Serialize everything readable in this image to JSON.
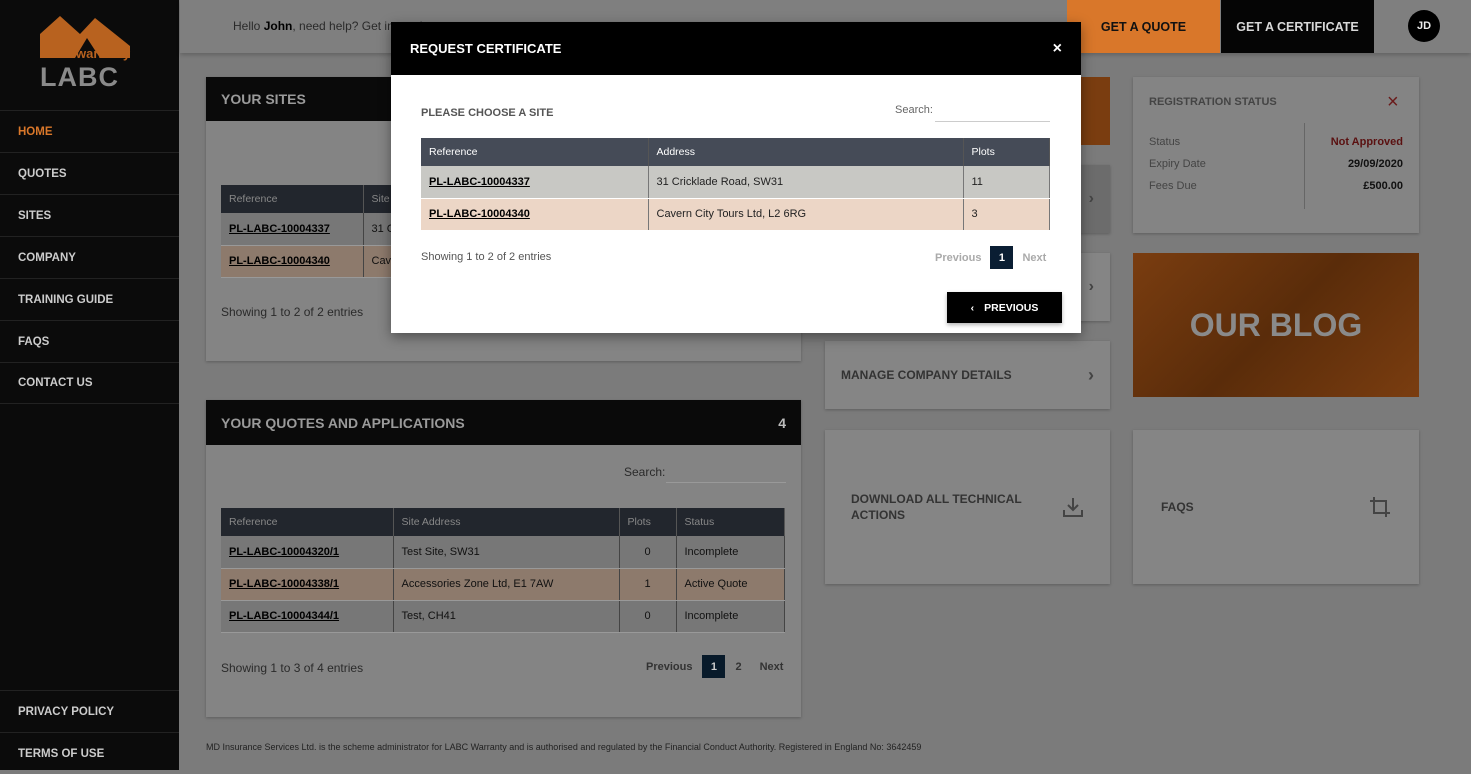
{
  "brand": {
    "logo_top": "warranty",
    "logo_bottom": "LABC",
    "accent": "#d9772a"
  },
  "sidebar": {
    "items": [
      {
        "label": "HOME",
        "active": true
      },
      {
        "label": "QUOTES"
      },
      {
        "label": "SITES"
      },
      {
        "label": "COMPANY"
      },
      {
        "label": "TRAINING GUIDE"
      },
      {
        "label": "FAQS"
      },
      {
        "label": "CONTACT US"
      }
    ],
    "bottom": [
      {
        "label": "PRIVACY POLICY"
      },
      {
        "label": "TERMS OF USE"
      }
    ]
  },
  "header": {
    "hello": "Hello ",
    "user": "John",
    "help": ", need help? Get in touch",
    "get_quote": "GET A QUOTE",
    "get_certificate": "GET A CERTIFICATE",
    "avatar": "JD"
  },
  "sites": {
    "title": "YOUR SITES",
    "columns": [
      "Reference",
      "Site"
    ],
    "rows": [
      {
        "ref": "PL-LABC-10004337",
        "site": "31 C"
      },
      {
        "ref": "PL-LABC-10004340",
        "site": "Cav"
      }
    ],
    "info": "Showing 1 to 2 of 2 entries"
  },
  "quotes": {
    "title": "YOUR QUOTES AND APPLICATIONS",
    "count": "4",
    "search_label": "Search:",
    "columns": [
      "Reference",
      "Site Address",
      "Plots",
      "Status"
    ],
    "rows": [
      {
        "ref": "PL-LABC-10004320/1",
        "address": "Test Site, SW31",
        "plots": "0",
        "status": "Incomplete"
      },
      {
        "ref": "PL-LABC-10004338/1",
        "address": "Accessories Zone Ltd, E1 7AW",
        "plots": "1",
        "status": "Active Quote"
      },
      {
        "ref": "PL-LABC-10004344/1",
        "address": "Test, CH41",
        "plots": "0",
        "status": "Incomplete"
      }
    ],
    "info": "Showing 1 to 3 of 4 entries",
    "prev": "Previous",
    "pages": [
      "1",
      "2"
    ],
    "next": "Next"
  },
  "registration": {
    "title": "REGISTRATION STATUS",
    "rows": [
      {
        "label": "Status",
        "value": "Not Approved"
      },
      {
        "label": "Expiry Date",
        "value": "29/09/2020"
      },
      {
        "label": "Fees Due",
        "value": "£500.00"
      }
    ]
  },
  "tiles": {
    "manage": "MANAGE COMPANY DETAILS",
    "download": "DOWNLOAD ALL TECHNICAL ACTIONS",
    "blog": "OUR BLOG",
    "faqs": "FAQS"
  },
  "footer": "MD Insurance Services Ltd. is the scheme administrator for LABC Warranty and is authorised and regulated by the Financial Conduct Authority. Registered in England No: 3642459",
  "modal": {
    "title": "REQUEST CERTIFICATE",
    "close": "×",
    "subtitle": "PLEASE CHOOSE A SITE",
    "search_label": "Search:",
    "columns": [
      "Reference",
      "Address",
      "Plots"
    ],
    "rows": [
      {
        "ref": "PL-LABC-10004337",
        "address": "31 Cricklade Road, SW31",
        "plots": "11"
      },
      {
        "ref": "PL-LABC-10004340",
        "address": "Cavern City Tours Ltd, L2 6RG",
        "plots": "3"
      }
    ],
    "info": "Showing 1 to 2 of 2 entries",
    "prev": "Previous",
    "page": "1",
    "next": "Next",
    "back_button": "PREVIOUS"
  }
}
